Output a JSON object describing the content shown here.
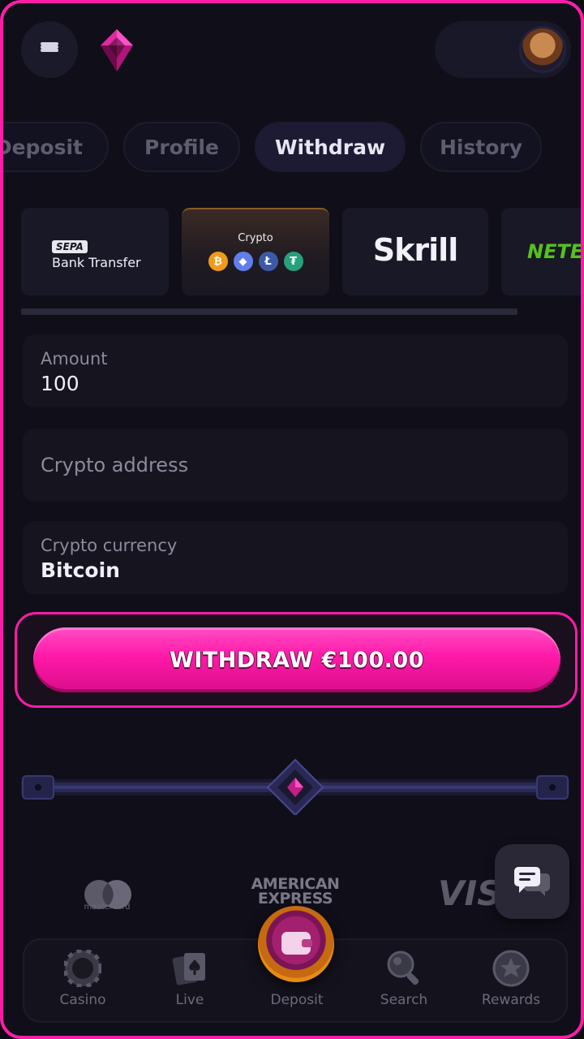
{
  "header": {
    "menu_icon": "hamburger-menu-icon",
    "logo_icon": "gem-logo-icon",
    "avatar_icon": "cowboy-avatar-icon"
  },
  "tabs": [
    {
      "label": "Deposit",
      "active": false
    },
    {
      "label": "Profile",
      "active": false
    },
    {
      "label": "Withdraw",
      "active": true
    },
    {
      "label": "History",
      "active": false
    }
  ],
  "methods": {
    "sepa": {
      "badge": "SEPA",
      "label": "Bank Transfer"
    },
    "crypto": {
      "label": "Crypto",
      "coins": [
        "₿",
        "◆",
        "Ł",
        "₮"
      ],
      "coin_colors": [
        "#f09a1a",
        "#627eea",
        "#3d5aa8",
        "#26a17b"
      ]
    },
    "skrill": {
      "label": "Skrill"
    },
    "neteller": {
      "label": "NETELLER"
    }
  },
  "form": {
    "amount": {
      "label": "Amount",
      "value": "100"
    },
    "address": {
      "placeholder": "Crypto address",
      "value": ""
    },
    "currency": {
      "label": "Crypto currency",
      "value": "Bitcoin"
    }
  },
  "withdraw_button": {
    "label": "WITHDRAW €100.00"
  },
  "brands": {
    "mastercard": "mastercard",
    "amex_line1": "AMERICAN",
    "amex_line2": "EXPRESS",
    "visa": "VISA"
  },
  "chat": {
    "icon": "chat-bubble-icon"
  },
  "nav": [
    {
      "label": "Casino",
      "icon": "casino-chip-icon"
    },
    {
      "label": "Live",
      "icon": "playing-cards-icon"
    },
    {
      "label": "Deposit",
      "icon": "wallet-icon"
    },
    {
      "label": "Search",
      "icon": "search-icon"
    },
    {
      "label": "Rewards",
      "icon": "star-medal-icon"
    }
  ],
  "colors": {
    "accent": "#ff1ca8",
    "background": "#100e18",
    "panel": "#15141f"
  }
}
